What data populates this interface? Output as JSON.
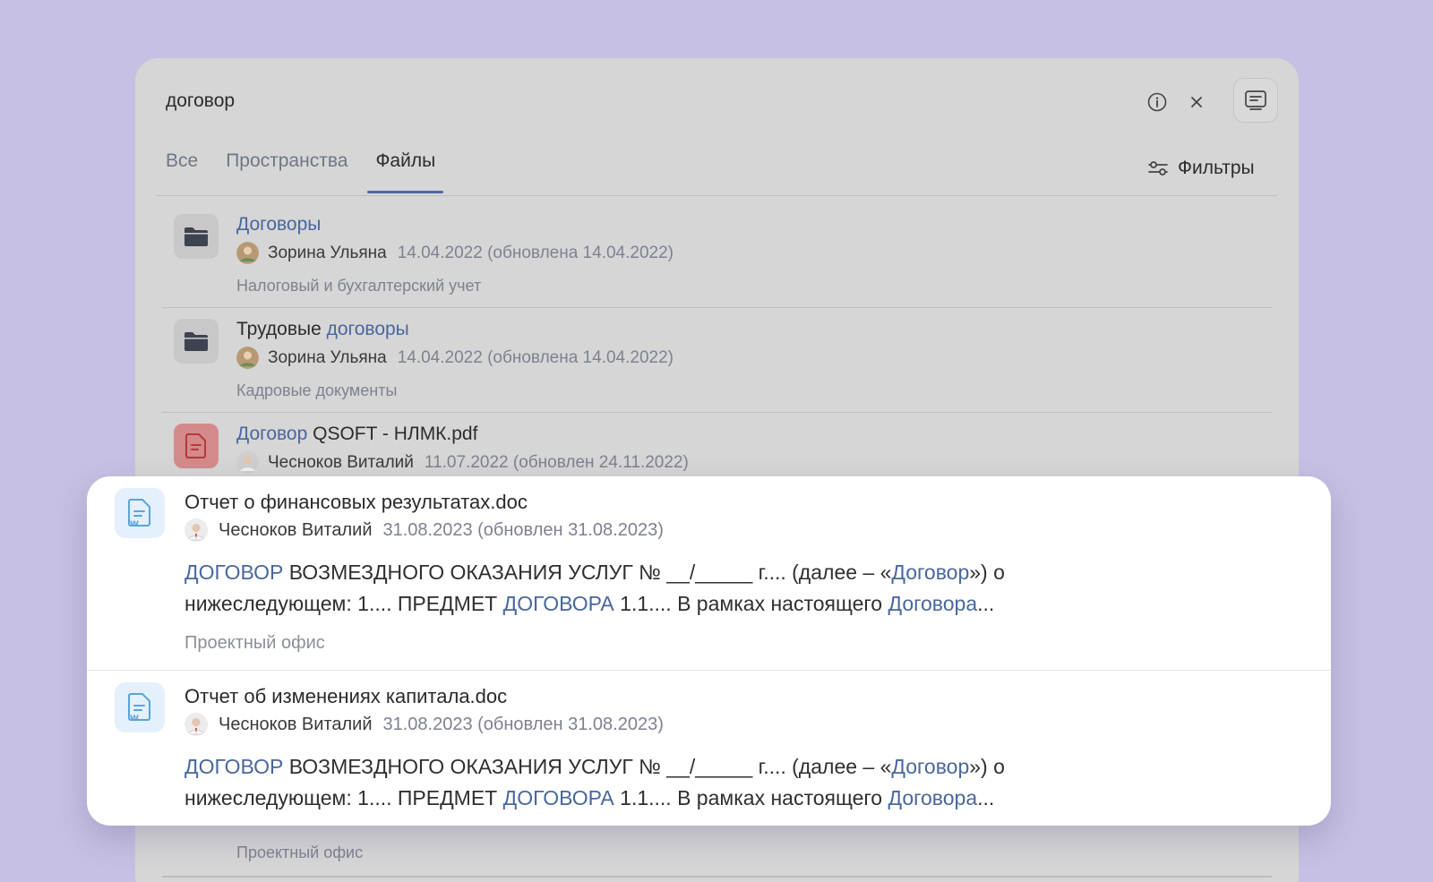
{
  "search": {
    "query": "договор"
  },
  "tabs": [
    {
      "label": "Все",
      "active": false
    },
    {
      "label": "Пространства",
      "active": false
    },
    {
      "label": "Файлы",
      "active": true
    }
  ],
  "filters_label": "Фильтры",
  "results": [
    {
      "type": "folder",
      "title_parts": [
        {
          "text": "Договоры",
          "hl": true
        }
      ],
      "author": "Зорина Ульяна",
      "date": "14.04.2022 (обновлена 14.04.2022)",
      "space": "Налоговый и бухгалтерский учет"
    },
    {
      "type": "folder",
      "title_parts": [
        {
          "text": "Трудовые ",
          "hl": false
        },
        {
          "text": "договоры",
          "hl": true
        }
      ],
      "author": "Зорина Ульяна",
      "date": "14.04.2022 (обновлена 14.04.2022)",
      "space": "Кадровые документы"
    },
    {
      "type": "pdf",
      "title_parts": [
        {
          "text": "Договор",
          "hl": true
        },
        {
          "text": " QSOFT - НЛМК.pdf",
          "hl": false
        }
      ],
      "author": "Чесноков Виталий",
      "date": "11.07.2022 (обновлен 24.11.2022)",
      "space": ""
    }
  ],
  "bottom_space": "Проектный офис",
  "card_items": [
    {
      "title": "Отчет о финансовых результатах.doc",
      "author": "Чесноков Виталий",
      "date": "31.08.2023 (обновлен 31.08.2023)",
      "snippet_parts": [
        {
          "text": "ДОГОВОР",
          "hl": true
        },
        {
          "text": " ВОЗМЕЗДНОГО ОКАЗАНИЯ УСЛУГ № __/_____ г.... (далее – «",
          "hl": false
        },
        {
          "text": "Договор",
          "hl": true
        },
        {
          "text": "») о нижеследующем: 1.... ПРЕДМЕТ ",
          "hl": false
        },
        {
          "text": "ДОГОВОРА",
          "hl": true
        },
        {
          "text": " 1.1.... В рамках настоящего ",
          "hl": false
        },
        {
          "text": "Договора",
          "hl": true
        },
        {
          "text": "...",
          "hl": false
        }
      ],
      "space": "Проектный офис"
    },
    {
      "title": "Отчет об изменениях капитала.doc",
      "author": "Чесноков Виталий",
      "date": "31.08.2023 (обновлен 31.08.2023)",
      "snippet_parts": [
        {
          "text": "ДОГОВОР",
          "hl": true
        },
        {
          "text": " ВОЗМЕЗДНОГО ОКАЗАНИЯ УСЛУГ № __/_____ г.... (далее – «",
          "hl": false
        },
        {
          "text": "Договор",
          "hl": true
        },
        {
          "text": "») о нижеследующем: 1.... ПРЕДМЕТ ",
          "hl": false
        },
        {
          "text": "ДОГОВОРА",
          "hl": true
        },
        {
          "text": " 1.1.... В рамках настоящего ",
          "hl": false
        },
        {
          "text": "Договора",
          "hl": true
        },
        {
          "text": "...",
          "hl": false
        }
      ],
      "space": ""
    }
  ],
  "colors": {
    "background": "#c6c1e2",
    "highlight": "#48679d",
    "tab_indicator": "#4d6aa0"
  },
  "icons": {
    "info": "info-circle-icon",
    "close": "close-icon",
    "toggle": "side-panel-icon",
    "filters": "filters-sliders-icon",
    "folder": "folder-icon",
    "pdf": "pdf-file-icon",
    "doc": "word-doc-icon"
  }
}
